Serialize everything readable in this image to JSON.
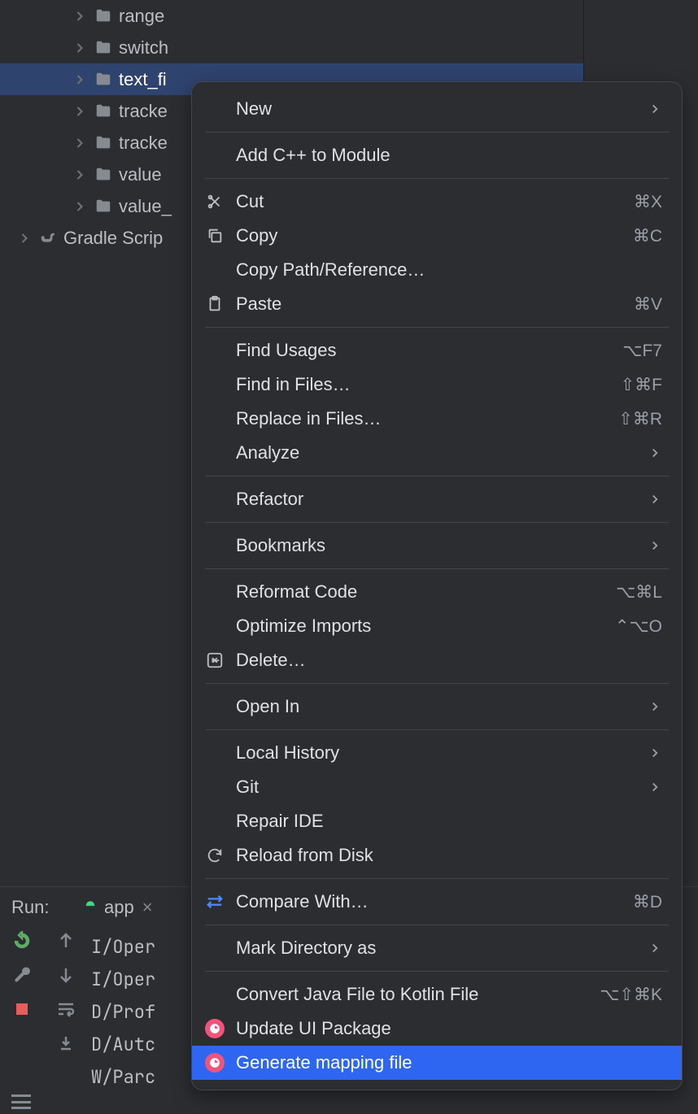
{
  "tree": {
    "items": [
      {
        "label": "range",
        "indent": 88
      },
      {
        "label": "switch",
        "indent": 88
      },
      {
        "label": "text_fi",
        "indent": 88,
        "selected": true
      },
      {
        "label": "tracke",
        "indent": 88
      },
      {
        "label": "tracke",
        "indent": 88
      },
      {
        "label": "value",
        "indent": 88
      },
      {
        "label": "value_",
        "indent": 88
      }
    ],
    "gradle": "Gradle Scrip"
  },
  "run": {
    "label": "Run:",
    "tab": "app"
  },
  "console": {
    "lines": [
      "I/Oper",
      "I/Oper",
      "D/Prof",
      "D/Autc",
      "W/Parc"
    ]
  },
  "menu": {
    "items": [
      {
        "label": "New",
        "arrow": true
      },
      {
        "divider": true
      },
      {
        "label": "Add C++ to Module"
      },
      {
        "divider": true
      },
      {
        "label": "Cut",
        "icon": "cut",
        "shortcut": "⌘X"
      },
      {
        "label": "Copy",
        "icon": "copy",
        "shortcut": "⌘C"
      },
      {
        "label": "Copy Path/Reference…"
      },
      {
        "label": "Paste",
        "icon": "paste",
        "shortcut": "⌘V"
      },
      {
        "divider": true
      },
      {
        "label": "Find Usages",
        "shortcut": "⌥F7"
      },
      {
        "label": "Find in Files…",
        "shortcut": "⇧⌘F"
      },
      {
        "label": "Replace in Files…",
        "shortcut": "⇧⌘R"
      },
      {
        "label": "Analyze",
        "arrow": true
      },
      {
        "divider": true
      },
      {
        "label": "Refactor",
        "arrow": true
      },
      {
        "divider": true
      },
      {
        "label": "Bookmarks",
        "arrow": true
      },
      {
        "divider": true
      },
      {
        "label": "Reformat Code",
        "shortcut": "⌥⌘L"
      },
      {
        "label": "Optimize Imports",
        "shortcut": "⌃⌥O"
      },
      {
        "label": "Delete…",
        "icon": "delete"
      },
      {
        "divider": true
      },
      {
        "label": "Open In",
        "arrow": true
      },
      {
        "divider": true
      },
      {
        "label": "Local History",
        "arrow": true
      },
      {
        "label": "Git",
        "arrow": true
      },
      {
        "label": "Repair IDE"
      },
      {
        "label": "Reload from Disk",
        "icon": "reload"
      },
      {
        "divider": true
      },
      {
        "label": "Compare With…",
        "icon": "compare",
        "shortcut": "⌘D"
      },
      {
        "divider": true
      },
      {
        "label": "Mark Directory as",
        "arrow": true
      },
      {
        "divider": true
      },
      {
        "label": "Convert Java File to Kotlin File",
        "shortcut": "⌥⇧⌘K"
      },
      {
        "label": "Update UI Package",
        "icon": "pink"
      },
      {
        "label": "Generate mapping file",
        "icon": "pink",
        "highlighted": true
      }
    ]
  }
}
